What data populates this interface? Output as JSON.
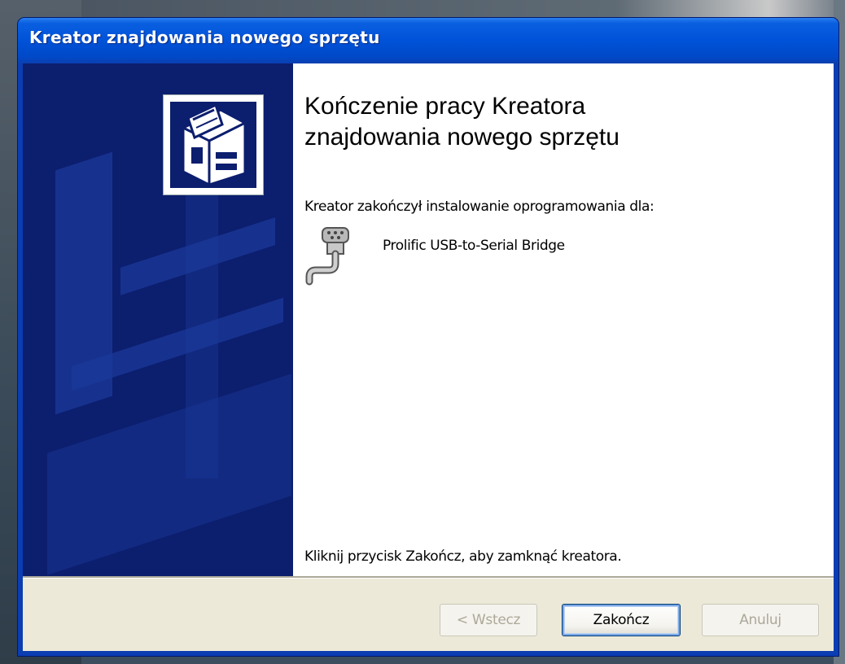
{
  "window": {
    "title": "Kreator znajdowania nowego sprzętu"
  },
  "content": {
    "heading_line1": "Kończenie pracy Kreatora",
    "heading_line2": "znajdowania nowego sprzętu",
    "intro": "Kreator zakończył instalowanie oprogramowania dla:",
    "device_name": "Prolific USB-to-Serial Bridge",
    "device_icon": "serial-port-icon",
    "hardware_icon": "hardware-wizard-icon",
    "footer_text": "Kliknij przycisk Zakończ, aby zamknąć kreatora."
  },
  "buttons": {
    "back_label": "< Wstecz",
    "finish_label": "Zakończ",
    "cancel_label": "Anuluj"
  },
  "colors": {
    "titlebar": "#0052d8",
    "side_panel": "#0c1e6e",
    "dialog_face": "#ece9d8",
    "focus_border": "#7aa6e6"
  }
}
